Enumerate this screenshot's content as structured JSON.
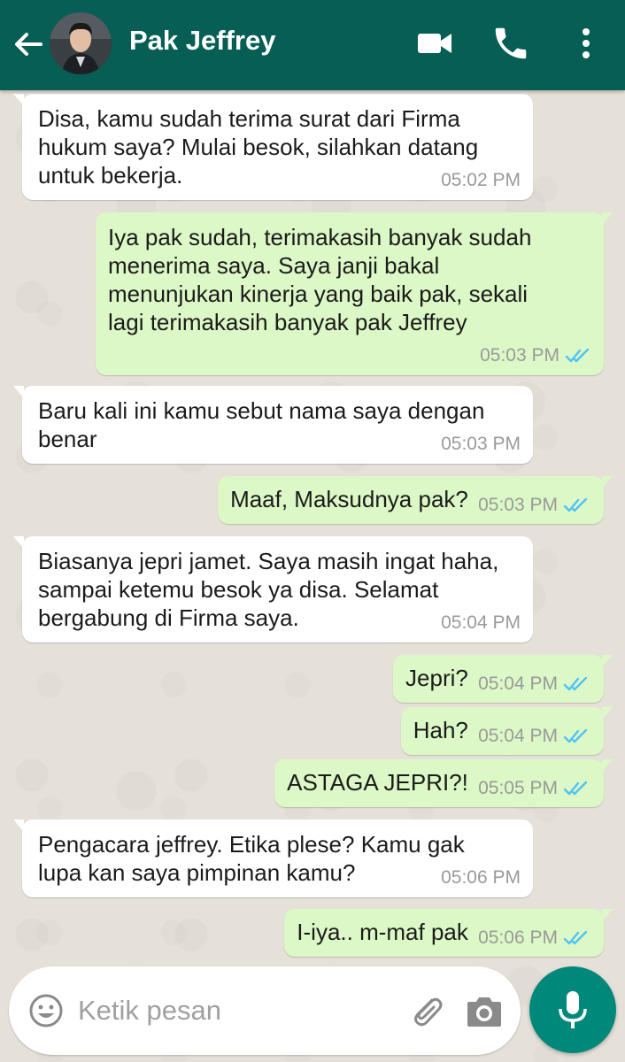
{
  "header": {
    "contact_name": "Pak Jeffrey"
  },
  "icons": {
    "back": "arrow-left-icon",
    "video": "video-call-icon",
    "call": "phone-icon",
    "menu": "more-vertical-icon",
    "emoji": "emoji-icon",
    "attach": "paperclip-icon",
    "camera": "camera-icon",
    "mic": "microphone-icon",
    "read_receipt": "double-check-icon"
  },
  "colors": {
    "header_bg": "#075e54",
    "incoming_bubble": "#ffffff",
    "outgoing_bubble": "#dcf8c6",
    "read_tick": "#4fc3f7",
    "mic_button": "#00897b"
  },
  "messages": [
    {
      "direction": "in",
      "text": "Disa, kamu sudah terima surat dari Firma\nhukum saya? Mulai besok, silahkan datang\nuntuk bekerja.",
      "time": "05:02 PM"
    },
    {
      "direction": "out",
      "text": "Iya pak sudah, terimakasih banyak sudah\nmenerima saya. Saya janji bakal\nmenunjukan kinerja yang baik pak, sekali\nlagi terimakasih banyak pak Jeffrey",
      "time": "05:03 PM",
      "read": true
    },
    {
      "direction": "in",
      "text": "Baru kali ini kamu sebut nama saya dengan\nbenar",
      "time": "05:03 PM"
    },
    {
      "direction": "out",
      "text": "Maaf, Maksudnya pak?",
      "time": "05:03 PM",
      "read": true
    },
    {
      "direction": "in",
      "text": "Biasanya jepri jamet. Saya masih ingat haha,\nsampai ketemu besok ya disa. Selamat\nbergabung di Firma saya.",
      "time": "05:04 PM"
    },
    {
      "direction": "out",
      "text": "Jepri?",
      "time": "05:04 PM",
      "read": true
    },
    {
      "direction": "out",
      "text": "Hah?",
      "time": "05:04 PM",
      "read": true
    },
    {
      "direction": "out",
      "text": "ASTAGA JEPRI?!",
      "time": "05:05 PM",
      "read": true
    },
    {
      "direction": "in",
      "text": "Pengacara jeffrey. Etika plese? Kamu gak\nlupa kan saya pimpinan kamu?",
      "time": "05:06 PM"
    },
    {
      "direction": "out",
      "text": "I-iya.. m-maf pak",
      "time": "05:06 PM",
      "read": true
    }
  ],
  "composer": {
    "placeholder": "Ketik pesan"
  }
}
